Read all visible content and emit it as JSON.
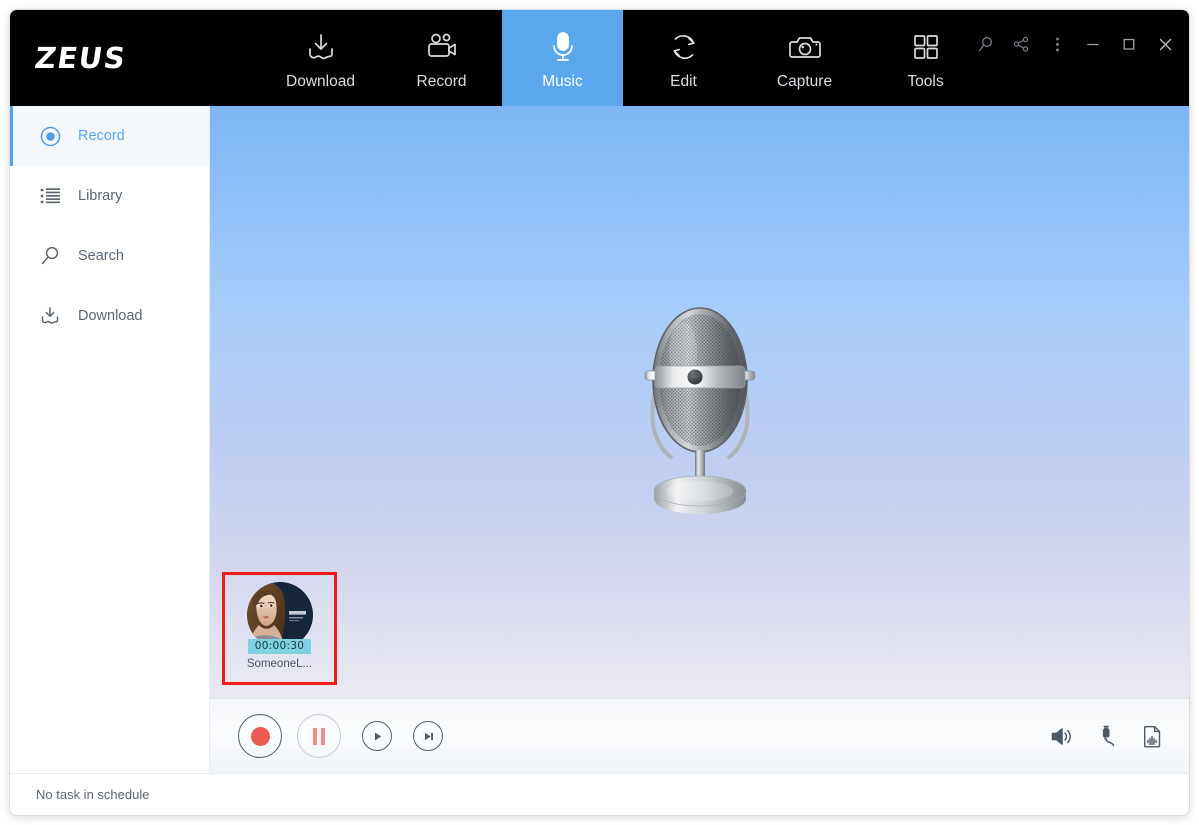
{
  "app": {
    "logo": "ZEUS"
  },
  "header": {
    "tabs": [
      {
        "label": "Download",
        "icon": "download-icon",
        "active": false
      },
      {
        "label": "Record",
        "icon": "camcorder-icon",
        "active": false
      },
      {
        "label": "Music",
        "icon": "microphone-icon",
        "active": true
      },
      {
        "label": "Edit",
        "icon": "refresh-icon",
        "active": false
      },
      {
        "label": "Capture",
        "icon": "camera-icon",
        "active": false
      },
      {
        "label": "Tools",
        "icon": "grid-icon",
        "active": false
      }
    ],
    "window_controls": [
      {
        "name": "search-icon",
        "glyph": "search"
      },
      {
        "name": "share-icon",
        "glyph": "share"
      },
      {
        "name": "more-menu-icon",
        "glyph": "dots"
      },
      {
        "name": "minimize-icon",
        "glyph": "minimize"
      },
      {
        "name": "maximize-icon",
        "glyph": "maximize"
      },
      {
        "name": "close-icon",
        "glyph": "close"
      }
    ],
    "active_tab_color": "#5ba7ee",
    "background_color": "#000000"
  },
  "sidebar": {
    "items": [
      {
        "label": "Record",
        "icon": "record-dot-icon",
        "active": true
      },
      {
        "label": "Library",
        "icon": "list-icon",
        "active": false
      },
      {
        "label": "Search",
        "icon": "magnifier-icon",
        "active": false
      },
      {
        "label": "Download",
        "icon": "download-icon",
        "active": false
      }
    ],
    "active_color": "#5ba7ee",
    "active_background": "#f4f7fb"
  },
  "stage": {
    "artwork": "studio-microphone",
    "background_top": "#7db6f6",
    "background_bottom": "#e6ebf2"
  },
  "recording_card": {
    "duration": "00:00:30",
    "title": "SomeoneL...",
    "highlight_color": "#ee1c16",
    "badge_color": "#7fd0e0",
    "artwork": "album-cover-portrait"
  },
  "player": {
    "controls": [
      {
        "name": "record-button",
        "icon": "record-circle-icon"
      },
      {
        "name": "pause-button",
        "icon": "pause-icon"
      },
      {
        "name": "play-button",
        "icon": "play-icon"
      },
      {
        "name": "next-track-button",
        "icon": "skip-next-icon"
      }
    ],
    "right_controls": [
      {
        "name": "volume-button",
        "icon": "speaker-icon"
      },
      {
        "name": "audio-input-button",
        "icon": "audio-jack-icon"
      },
      {
        "name": "audio-file-button",
        "icon": "audio-file-icon"
      }
    ],
    "record_dot_color": "#ec5b52",
    "pause_bar_color": "#ef8d87"
  },
  "statusbar": {
    "message": "No task in schedule"
  }
}
